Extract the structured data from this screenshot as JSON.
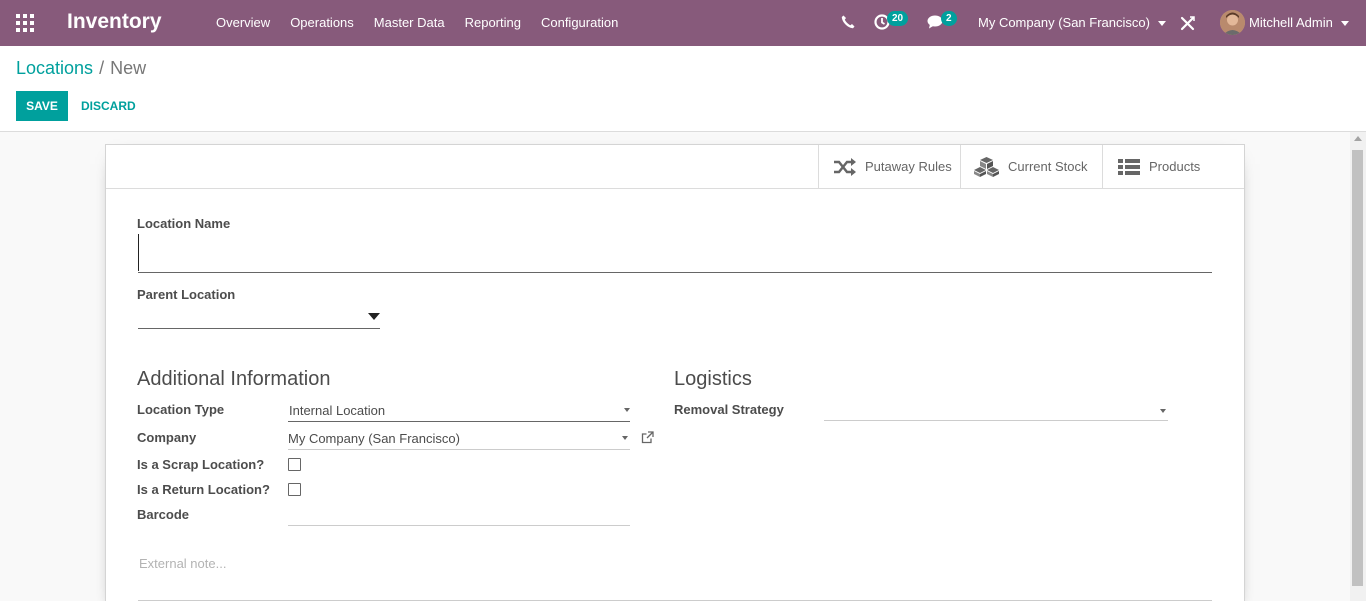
{
  "navbar": {
    "app_title": "Inventory",
    "menu": [
      "Overview",
      "Operations",
      "Master Data",
      "Reporting",
      "Configuration"
    ],
    "activity_count": "20",
    "message_count": "2",
    "company": "My Company (San Francisco)",
    "user": "Mitchell Admin",
    "bar_color": "#875a7b"
  },
  "breadcrumb": {
    "parent": "Locations",
    "separator": "/",
    "current": "New"
  },
  "actions": {
    "save": "SAVE",
    "discard": "DISCARD",
    "primary_color": "#00a09d"
  },
  "smart_buttons": {
    "putaway": "Putaway Rules",
    "stock": "Current Stock",
    "products": "Products"
  },
  "form": {
    "location_name_label": "Location Name",
    "location_name_value": "",
    "parent_location_label": "Parent Location",
    "parent_location_value": "",
    "additional_info_title": "Additional Information",
    "location_type_label": "Location Type",
    "location_type_value": "Internal Location",
    "company_label": "Company",
    "company_value": "My Company (San Francisco)",
    "scrap_label": "Is a Scrap Location?",
    "scrap_checked": false,
    "return_label": "Is a Return Location?",
    "return_checked": false,
    "barcode_label": "Barcode",
    "barcode_value": "",
    "logistics_title": "Logistics",
    "removal_strategy_label": "Removal Strategy",
    "removal_strategy_value": "",
    "note_placeholder": "External note..."
  }
}
